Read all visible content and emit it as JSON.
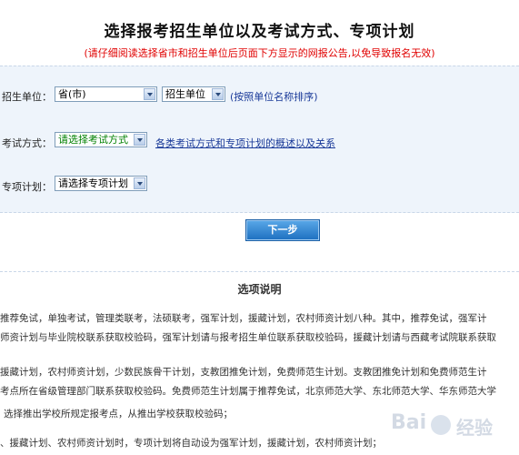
{
  "header": {
    "title": "选择报考招生单位以及考试方式、专项计划",
    "notice": "(请仔细阅读选择省市和招生单位后页面下方显示的网报公告,以免导致报名无效)"
  },
  "form": {
    "unit_label": "招生单位：",
    "province_select": "省(市)",
    "unit_select": "招生单位",
    "sort_link": "(按照单位名称排序)",
    "exam_label": "考试方式：",
    "exam_select": "请选择考试方式",
    "exam_help_link": "各类考试方式和专项计划的概述以及关系",
    "plan_label": "专项计划：",
    "plan_select": "请选择专项计划",
    "next_button": "下一步"
  },
  "notes": {
    "title": "选项说明",
    "lines": [
      "推荐免试，单独考试，管理类联考，法硕联考，强军计划，援藏计划，农村师资计划八种。其中，推荐免试，强军计",
      "师资计划与毕业院校联系获取校验码，强军计划请与报考招生单位联系获取校验码，援藏计划请与西藏考试院联系获取",
      "援藏计划，农村师资计划，少数民族骨干计划，支教团推免计划，免费师范生计划。支教团推免计划和免费师范生计",
      "考点所在省级管理部门联系获取校验码。免费师范生计划属于推荐免试，北京师范大学、东北师范大学、华东师范大学",
      "选择推出学校所规定报考点，从推出学校获取校验码；",
      "、援藏计划、农村师资计划时，专项计划将自动设为强军计划，援藏计划，农村师资计划；"
    ]
  },
  "watermark": {
    "text": "Bai",
    "suffix": "经验"
  }
}
